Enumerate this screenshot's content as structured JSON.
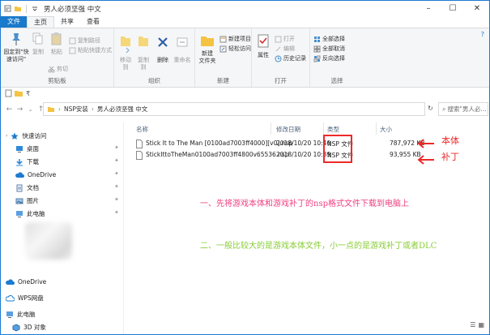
{
  "window": {
    "title": "男人必须坚强 中文"
  },
  "menu": {
    "file": "文件",
    "home": "主页",
    "share": "共享",
    "view": "查看"
  },
  "ribbon": {
    "pin_quick": "固定到\"快\n速访问\"",
    "copy": "复制",
    "paste": "粘贴",
    "copy_path": "复制路径",
    "paste_shortcut": "粘贴快捷方式",
    "cut": "剪切",
    "clipboard_group": "剪贴板",
    "move_to": "移动到",
    "copy_to": "复制到",
    "delete": "删除",
    "rename": "重命名",
    "organize_group": "组织",
    "new_folder": "新建\n文件夹",
    "new_item": "新建项目",
    "easy_access": "轻松访问",
    "new_group": "新建",
    "properties": "属性",
    "open": "打开",
    "edit": "编辑",
    "history": "历史记录",
    "open_group": "打开",
    "select_all": "全部选择",
    "select_none": "全部取消",
    "invert_selection": "反向选择",
    "select_group": "选择"
  },
  "address": {
    "breadcrumb": [
      "NSP安装",
      "男人必须坚强 中文"
    ],
    "search_placeholder": "搜索\"男人必..."
  },
  "nav": {
    "items": [
      {
        "label": "快速访问",
        "icon": "star-icon"
      },
      {
        "label": "桌面",
        "icon": "desktop-icon"
      },
      {
        "label": "下载",
        "icon": "download-icon"
      },
      {
        "label": "OneDrive",
        "icon": "cloud-icon"
      },
      {
        "label": "文档",
        "icon": "document-icon"
      },
      {
        "label": "图片",
        "icon": "picture-icon"
      },
      {
        "label": "此电脑",
        "icon": "computer-icon"
      },
      {
        "label": "OneDrive",
        "icon": "cloud-icon"
      },
      {
        "label": "WPS网盘",
        "icon": "wps-cloud-icon"
      },
      {
        "label": "此电脑",
        "icon": "computer-icon"
      },
      {
        "label": "3D 对象",
        "icon": "cube-icon"
      }
    ]
  },
  "files": {
    "columns": {
      "name": "名称",
      "date": "修改日期",
      "type": "类型",
      "size": "大小"
    },
    "rows": [
      {
        "name": "Stick It to The Man [0100ad7003ff4000][v0].nsp",
        "date": "2018/10/20 10:40",
        "type": "NSP 文件",
        "size": "787,972 KB"
      },
      {
        "name": "StickIttoTheMan0100ad7003ff4800v65536.nsp",
        "date": "2018/10/20 10:39",
        "type": "NSP 文件",
        "size": "93,955 KB"
      }
    ]
  },
  "annotations": {
    "base": "本体",
    "patch": "补丁",
    "step1": "一、先将游戏本体和游戏补丁的nsp格式文件下载到电脑上",
    "step2": "二、一般比较大的是游戏本体文件，小一点的是游戏补丁或者DLC"
  },
  "colors": {
    "accent": "#1979ca",
    "annotation_red": "#ec2a2a",
    "annotation_pink": "#f04080",
    "annotation_green": "#88cc33",
    "folder": "#f5c342"
  }
}
